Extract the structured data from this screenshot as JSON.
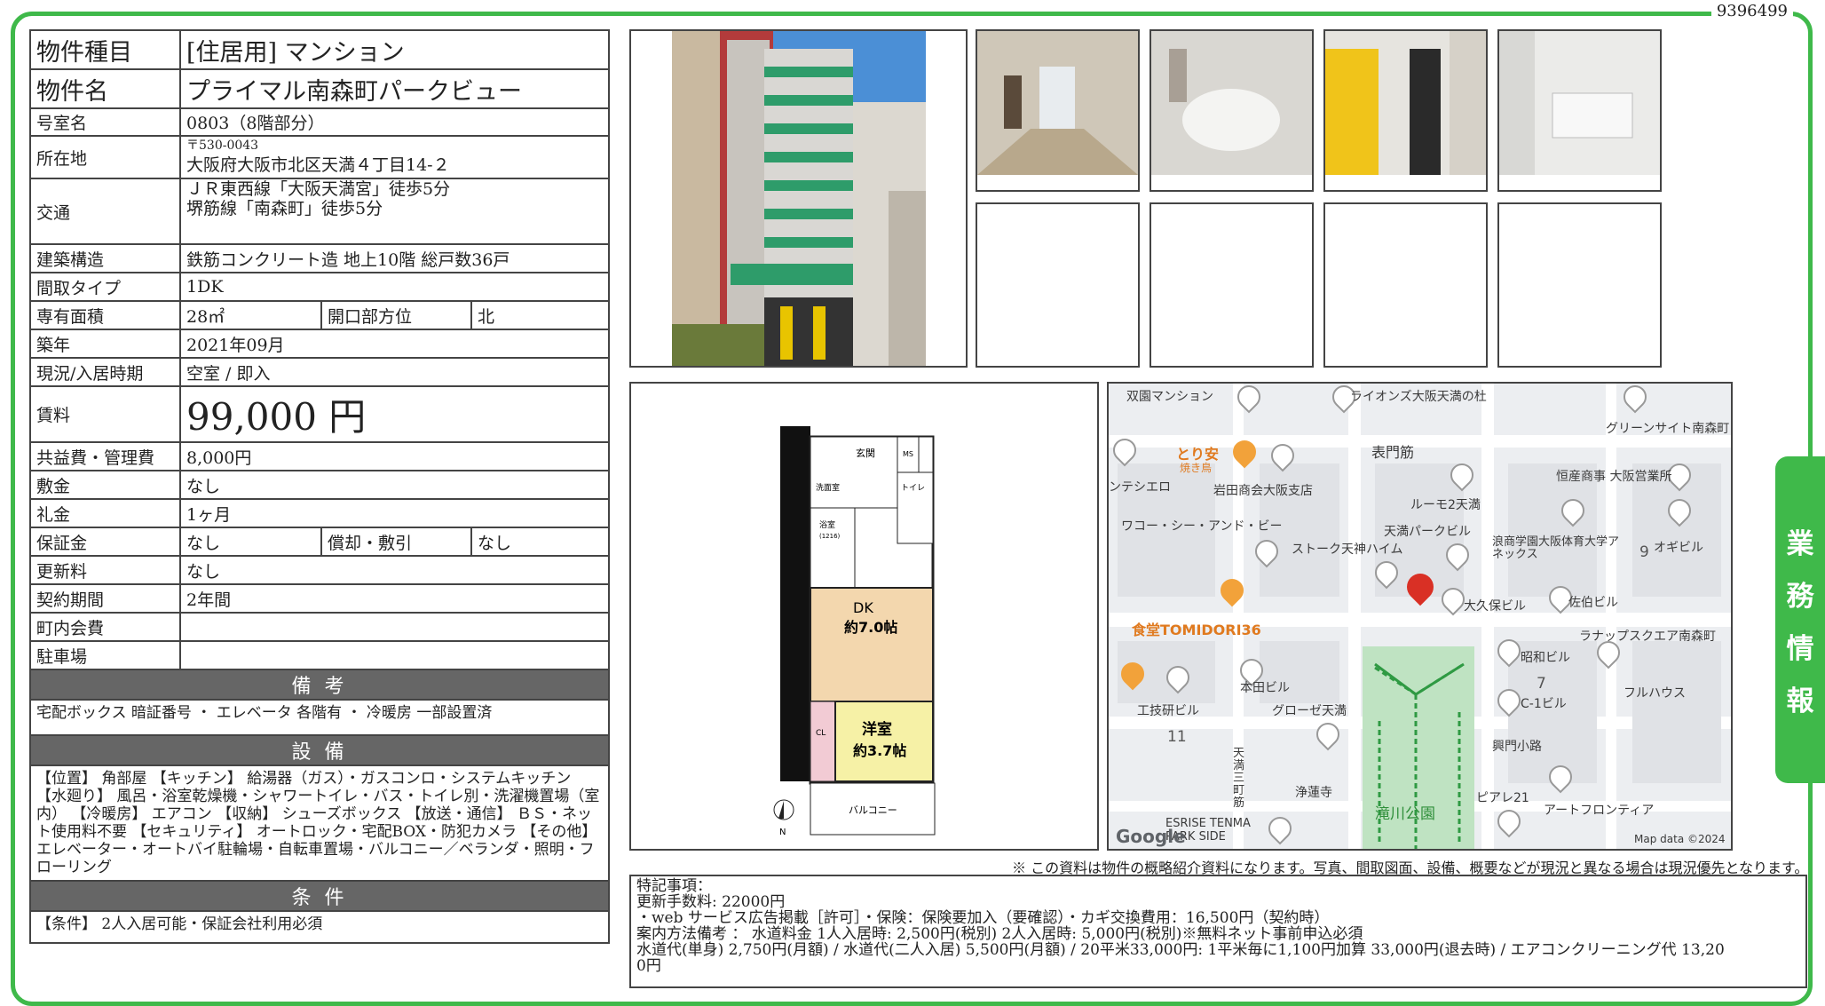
{
  "doc_id": "9396499",
  "side_tab": [
    "業",
    "務",
    "情",
    "報"
  ],
  "spec": {
    "type_label": "物件種目",
    "type_value": "[住居用]  マンション",
    "name_label": "物件名",
    "name_value": "プライマル南森町パークビュー",
    "room_label": "号室名",
    "room_value": "0803（8階部分）",
    "addr_label": "所在地",
    "addr_postal": "〒530-0043",
    "addr_value": "大阪府大阪市北区天満４丁目14-２",
    "access_label": "交通",
    "access_1": "ＪＲ東西線「大阪天満宮」徒歩5分",
    "access_2": "堺筋線「南森町」徒歩5分",
    "structure_label": "建築構造",
    "structure_value": "鉄筋コンクリート造  地上10階  総戸数36戸",
    "layout_label": "間取タイプ",
    "layout_value": "1DK",
    "area_label": "専有面積",
    "area_value": "28㎡",
    "facing_label": "開口部方位",
    "facing_value": "北",
    "built_label": "築年",
    "built_value": "2021年09月",
    "status_label": "現況/入居時期",
    "status_value": "空室  /  即入",
    "rent_label": "賃料",
    "rent_value": "99,000 円",
    "fee_label": "共益費・管理費",
    "fee_value": "8,000円",
    "deposit_label": "敷金",
    "deposit_value": "なし",
    "key_label": "礼金",
    "key_value": "1ヶ月",
    "guarantee_label": "保証金",
    "guarantee_value": "なし",
    "amort_label": "償却・敷引",
    "amort_value": "なし",
    "renew_label": "更新料",
    "renew_value": "なし",
    "contract_label": "契約期間",
    "contract_value": "2年間",
    "town_label": "町内会費",
    "town_value": "",
    "parking_label": "駐車場",
    "parking_value": "",
    "remarks_header": "備 考",
    "remarks_text": "宅配ボックス 暗証番号  ・  エレベータ  各階有  ・  冷暖房  一部設置済",
    "equip_header": "設 備",
    "equip_text": "【位置】 角部屋  【キッチン】 給湯器（ガス）・ガスコンロ・システムキッチン  【水廻り】 風呂・浴室乾燥機・シャワートイレ・バス・トイレ別・洗濯機置場（室内）  【冷暖房】 エアコン  【収納】 シューズボックス  【放送・通信】 ＢＳ・ネット使用料不要  【セキュリティ】 オートロック・宅配BOX・防犯カメラ  【その他】 エレベーター・オートバイ駐輪場・自転車置場・バルコニー／ベランダ・照明・フローリング",
    "cond_header": "条 件",
    "cond_text": "【条件】 2人入居可能・保証会社利用必須"
  },
  "floorplan": {
    "entrance": "玄関",
    "ms": "MS",
    "wash": "洗面室",
    "toilet": "トイレ",
    "bath": "浴室",
    "bath_size": "(1216)",
    "dk": "DK",
    "dk_size": "約7.0帖",
    "western": "洋室",
    "western_size": "約3.7帖",
    "cl": "CL",
    "balcony": "バルコニー",
    "north": "N"
  },
  "map": {
    "labels": [
      "双園マンション",
      "ライオンズ大阪天満の杜",
      "グリーンサイト南森町",
      "表門筋",
      "とり安",
      "焼き鳥",
      "岩田商会大阪支店",
      "恒産商事 大阪営業所",
      "ンテシエロ",
      "ルーモ2天満",
      "ワコー・シー・アンド・ビー",
      "天満パークビル",
      "浪商学園大阪体育大学アネックス",
      "オギビル",
      "ストーク天神ハイム",
      "大久保ビル",
      "佐伯ビル",
      "食堂TOMIDORI36",
      "ラナップスクエア南森町",
      "昭和ビル",
      "本田ビル",
      "C-1ビル",
      "フルハウス",
      "工技研ビル",
      "グローゼ天満",
      "興門小路",
      "浄蓮寺",
      "滝川公園",
      "ピアレ21",
      "アートフロンティア",
      "ESRISE TENMA PARK SIDE",
      "Google",
      "Map data ©2024",
      "9",
      "7",
      "11",
      "天満三町筋"
    ]
  },
  "note": "※ この資料は物件の概略紹介資料になります。写真、間取図面、設備、概要などが現況と異なる場合は現況優先となります。",
  "special": {
    "line1": "特記事項：",
    "line2": "更新手数料: 22000円",
    "line3": "・web サービス広告掲載［許可］・保険：保険要加入（要確認）・カギ交換費用：16,500円（契約時）",
    "line4": "案内方法備考 ：  水道料金  1人入居時: 2,500円(税別)  2人入居時: 5,000円(税別)※無料ネット事前申込必須",
    "line5": "水道代(単身)  2,750円(月額)  /  水道代(二人入居)  5,500円(月額)  /  20平米33,000円: 1平米毎に1,100円加算  33,000円(退去時)  /  エアコンクリーニング代  13,20",
    "line6": "0円"
  },
  "colors": {
    "green": "#3fb94a",
    "section_gray": "#666666",
    "pin_red": "#d93025"
  }
}
